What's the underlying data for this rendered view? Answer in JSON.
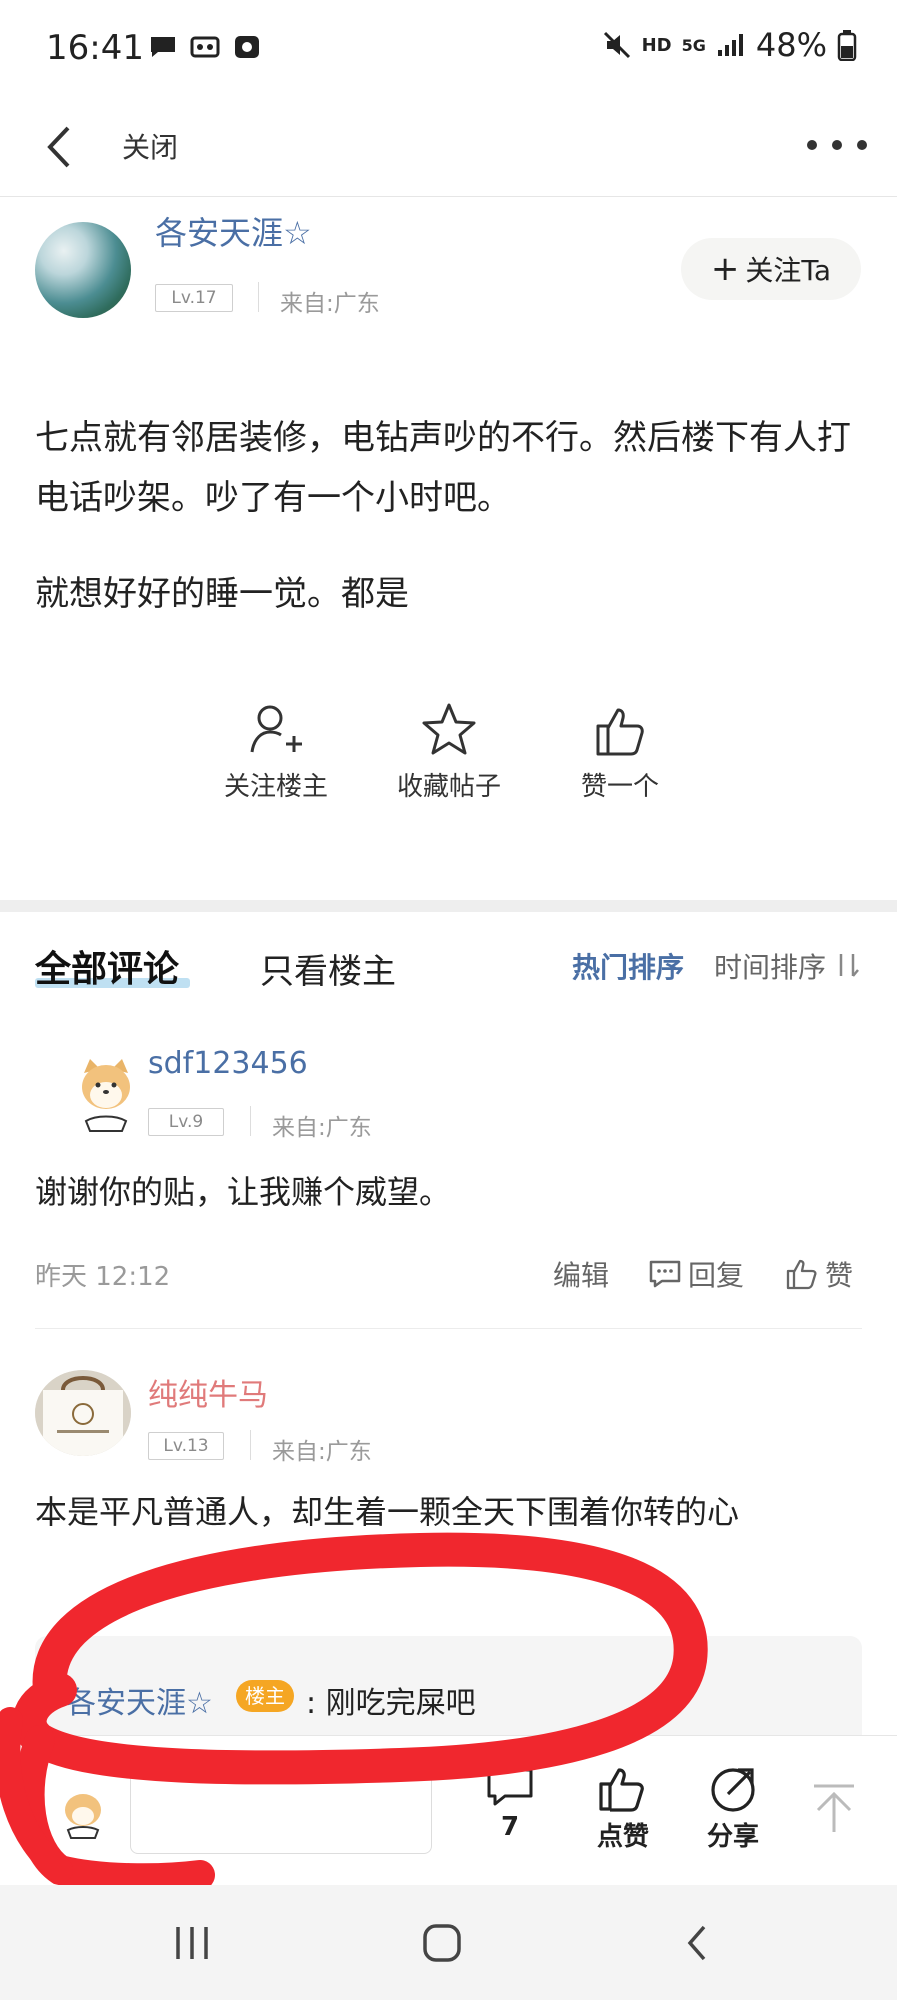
{
  "status_bar": {
    "time": "16:41",
    "network": "HD",
    "signal": "5G",
    "battery": "48%"
  },
  "nav": {
    "close_label": "关闭"
  },
  "post": {
    "author": {
      "name": "各安天涯☆",
      "level": "Lv.17",
      "from": "来自:广东"
    },
    "follow_label": "关注Ta",
    "paragraphs": [
      "七点就有邻居装修，电钻声吵的不行。然后楼下有人打电话吵架。吵了有一个小时吧。",
      "就想好好的睡一觉。都是"
    ],
    "actions": [
      {
        "label": "关注楼主",
        "icon": "add-user-icon"
      },
      {
        "label": "收藏帖子",
        "icon": "star-icon"
      },
      {
        "label": "赞一个",
        "icon": "thumbs-up-icon"
      }
    ]
  },
  "comment_tabs": {
    "all": "全部评论",
    "op_only": "只看楼主",
    "sort_hot": "热门排序",
    "sort_time": "时间排序"
  },
  "comments": [
    {
      "name": "sdf123456",
      "level": "Lv.9",
      "from": "来自:广东",
      "text": "谢谢你的贴，让我赚个威望。",
      "time": "昨天 12:12",
      "edit": "编辑",
      "reply": "回复",
      "like": "赞"
    },
    {
      "name": "纯纯牛马",
      "level": "Lv.13",
      "from": "来自:广东",
      "text": "本是平凡普通人，却生着一颗全天下围着你转的心"
    }
  ],
  "reply": {
    "name": "各安天涯☆",
    "badge": "楼主",
    "text": ": 刚吃完屎吧"
  },
  "bottom_bar": {
    "comment_count": "7",
    "like_label": "点赞",
    "share_label": "分享"
  },
  "colors": {
    "link_blue": "#4a6fa5",
    "name_pink": "#e07a7a",
    "badge_orange": "#f5a623",
    "annotation_red": "#f0272e"
  }
}
